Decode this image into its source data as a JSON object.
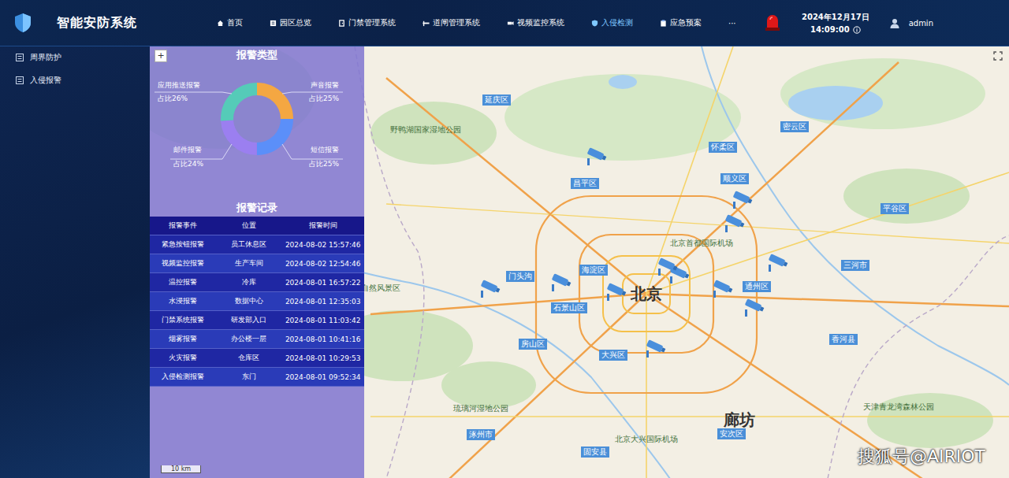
{
  "header": {
    "title": "智能安防系统",
    "nav": [
      {
        "label": "首页",
        "selected": false
      },
      {
        "label": "园区总览",
        "selected": false
      },
      {
        "label": "门禁管理系统",
        "selected": false
      },
      {
        "label": "道闸管理系统",
        "selected": false
      },
      {
        "label": "视频监控系统",
        "selected": false
      },
      {
        "label": "入侵检测",
        "selected": true
      },
      {
        "label": "应急预案",
        "selected": false
      }
    ],
    "more": "···",
    "date": "2024年12月17日",
    "time": "14:09:00",
    "user": "admin"
  },
  "sidebar": {
    "items": [
      {
        "label": "周界防护",
        "selected": false
      },
      {
        "label": "入侵报警",
        "selected": false
      }
    ]
  },
  "map": {
    "zoom_in": "+",
    "scale": "10 km",
    "labels": [
      {
        "text": "北京",
        "kind": "city"
      },
      {
        "text": "廊坊",
        "kind": "city"
      },
      {
        "text": "昌平区",
        "kind": "district"
      },
      {
        "text": "顺义区",
        "kind": "district"
      },
      {
        "text": "怀柔区",
        "kind": "district"
      },
      {
        "text": "密云区",
        "kind": "district"
      },
      {
        "text": "延庆区",
        "kind": "district"
      },
      {
        "text": "平谷区",
        "kind": "district"
      },
      {
        "text": "海淀区",
        "kind": "district"
      },
      {
        "text": "石景山区",
        "kind": "district"
      },
      {
        "text": "门头沟",
        "kind": "district"
      },
      {
        "text": "房山区",
        "kind": "district"
      },
      {
        "text": "大兴区",
        "kind": "district"
      },
      {
        "text": "通州区",
        "kind": "district"
      },
      {
        "text": "三河市",
        "kind": "district"
      },
      {
        "text": "香河县",
        "kind": "district"
      },
      {
        "text": "涿州市",
        "kind": "district"
      },
      {
        "text": "固安县",
        "kind": "district"
      },
      {
        "text": "安次区",
        "kind": "district"
      },
      {
        "text": "北京首都国际机场",
        "kind": "poi"
      },
      {
        "text": "北京大兴国际机场",
        "kind": "poi"
      },
      {
        "text": "天津青龙湾森林公园",
        "kind": "poi"
      },
      {
        "text": "双龙峡自然风景区",
        "kind": "poi"
      },
      {
        "text": "野鸭湖国家湿地公园",
        "kind": "poi"
      },
      {
        "text": "琉璃河湿地公园",
        "kind": "poi"
      }
    ]
  },
  "alarm_types": {
    "title": "报警类型",
    "series": [
      {
        "name": "声音报警",
        "share": "占比25%",
        "value": 25,
        "color": "#f4a742"
      },
      {
        "name": "短信报警",
        "share": "占比25%",
        "value": 25,
        "color": "#5b8ff9"
      },
      {
        "name": "邮件报警",
        "share": "占比24%",
        "value": 24,
        "color": "#9b7ff0"
      },
      {
        "name": "应用推送报警",
        "share": "占比26%",
        "value": 26,
        "color": "#55cbb8"
      }
    ]
  },
  "alarm_records": {
    "title": "报警记录",
    "columns": [
      "报警事件",
      "位置",
      "报警时间"
    ],
    "rows": [
      [
        "紧急按钮报警",
        "员工休息区",
        "2024-08-02 15:57:46"
      ],
      [
        "视频监控报警",
        "生产车间",
        "2024-08-02 12:54:46"
      ],
      [
        "温控报警",
        "冷库",
        "2024-08-01 16:57:22"
      ],
      [
        "水浸报警",
        "数据中心",
        "2024-08-01 12:35:03"
      ],
      [
        "门禁系统报警",
        "研发部入口",
        "2024-08-01 11:03:42"
      ],
      [
        "烟雾报警",
        "办公楼一层",
        "2024-08-01 10:41:16"
      ],
      [
        "火灾报警",
        "仓库区",
        "2024-08-01 10:29:53"
      ],
      [
        "入侵检测报警",
        "东门",
        "2024-08-01 09:52:34"
      ]
    ]
  },
  "watermark": "搜狐号@AIRIOT"
}
